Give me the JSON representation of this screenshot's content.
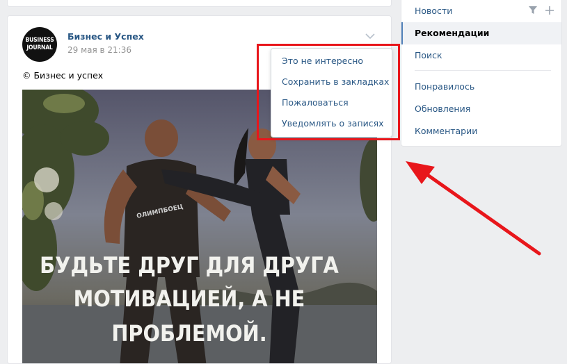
{
  "post": {
    "avatar_line1": "BUSINESS",
    "avatar_line2": "JOURNAL",
    "author": "Бизнес и Успех",
    "date": "29 мая в 21:36",
    "text": "© Бизнес и успех",
    "image_caption_line1": "БУДЬТЕ ДРУГ ДЛЯ ДРУГА",
    "image_caption_line2": "МОТИВАЦИЕЙ, А НЕ",
    "image_caption_line3": "ПРОБЛЕМОЙ.",
    "shirt_text": "ОЛИМПБОЕЦ"
  },
  "menu": {
    "items": [
      "Это не интересно",
      "Сохранить в закладках",
      "Пожаловаться",
      "Уведомлять о записях"
    ]
  },
  "sidebar": {
    "items": [
      {
        "label": "Новости"
      },
      {
        "label": "Рекомендации"
      },
      {
        "label": "Поиск"
      },
      {
        "label": "Понравилось"
      },
      {
        "label": "Обновления"
      },
      {
        "label": "Комментарии"
      }
    ]
  },
  "colors": {
    "link": "#2a5885",
    "highlight": "#e8161b",
    "active_border": "#5181b8",
    "background": "#edeef0"
  },
  "icons": [
    "chevron-down-icon",
    "filter-icon",
    "plus-icon",
    "arrow-annotation"
  ]
}
